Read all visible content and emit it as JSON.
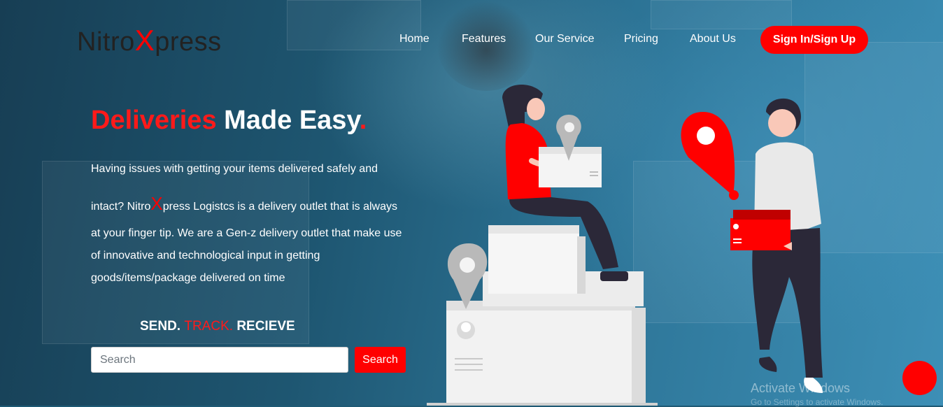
{
  "brand": {
    "name_part1": "Nitro",
    "name_x": "X",
    "name_part2": "press"
  },
  "nav": {
    "items": [
      {
        "label": "Home"
      },
      {
        "label": "Features"
      },
      {
        "label": "Our Service"
      },
      {
        "label": "Pricing"
      },
      {
        "label": "About Us"
      }
    ],
    "cta_label": "Sign In/Sign Up"
  },
  "hero": {
    "headline_red": "Deliveries",
    "headline_white": " Made Easy",
    "headline_dot": ".",
    "paragraph": {
      "line1": "Having issues with getting your items delivered safely and",
      "line2_pre": "intact? Nitro",
      "line2_x": "X",
      "line2_post": "press Logistcs is a delivery outlet that is always",
      "line3": "at your finger tip. We are a Gen-z delivery outlet that make use",
      "line4": "of innovative and technological input in getting",
      "line5": "goods/items/package delivered on time"
    },
    "tagline": {
      "send": "SEND. ",
      "track": "TRACK. ",
      "receive": "RECIEVE"
    }
  },
  "search": {
    "placeholder": "Search",
    "value": "",
    "button_label": "Search"
  },
  "overlay": {
    "watermark": "Activate Windows",
    "watermark_sub": "Go to Settings to activate Windows."
  },
  "colors": {
    "accent": "#ff0000",
    "dark_text": "#222222",
    "background": "#1f5a75"
  }
}
